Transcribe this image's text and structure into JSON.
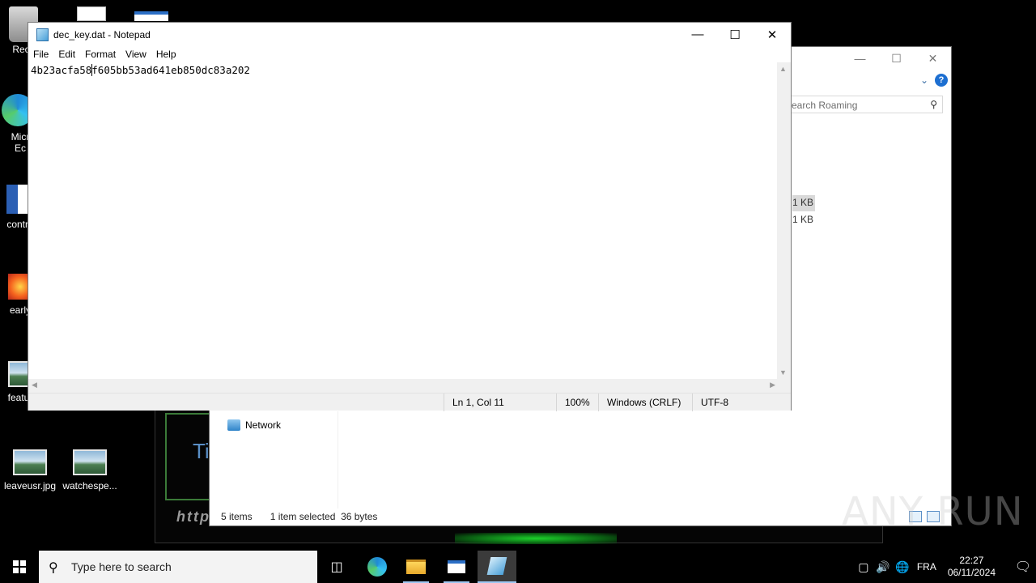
{
  "desktop": {
    "icons": [
      {
        "label": "Recy",
        "kind": "recycle-bin"
      },
      {
        "label": "Micr",
        "label2": "Ec",
        "kind": "edge"
      },
      {
        "label": "contra",
        "kind": "word"
      },
      {
        "label": "early",
        "kind": "app"
      },
      {
        "label": "featur",
        "kind": "image"
      },
      {
        "label": "leaveusr.jpg",
        "kind": "image"
      },
      {
        "label": "watchespe...",
        "kind": "image"
      }
    ]
  },
  "background_window": {
    "heading_fragment": "Ti",
    "url_fragment": "http"
  },
  "explorer": {
    "search_placeholder": "earch Roaming",
    "sizes": [
      "1 KB",
      "1 KB"
    ],
    "nav_network": "Network",
    "status_items": "5 items",
    "status_selected": "1 item selected  36 bytes",
    "help": "?"
  },
  "notepad": {
    "title": "dec_key.dat - Notepad",
    "menu": [
      "File",
      "Edit",
      "Format",
      "View",
      "Help"
    ],
    "content_before_caret": "4b23acfa58",
    "content_after_caret": "f605bb53ad641eb850dc83a202",
    "status": {
      "position": "Ln 1, Col 11",
      "zoom": "100%",
      "line_ending": "Windows (CRLF)",
      "encoding": "UTF-8"
    }
  },
  "watermark": "ANY RUN",
  "taskbar": {
    "search_placeholder": "Type here to search",
    "language": "FRA",
    "time": "22:27",
    "date": "06/11/2024"
  },
  "colors": {
    "taskbar_bg": "#000000",
    "accent": "#9ec7f2",
    "help_blue": "#1d6fd1"
  }
}
